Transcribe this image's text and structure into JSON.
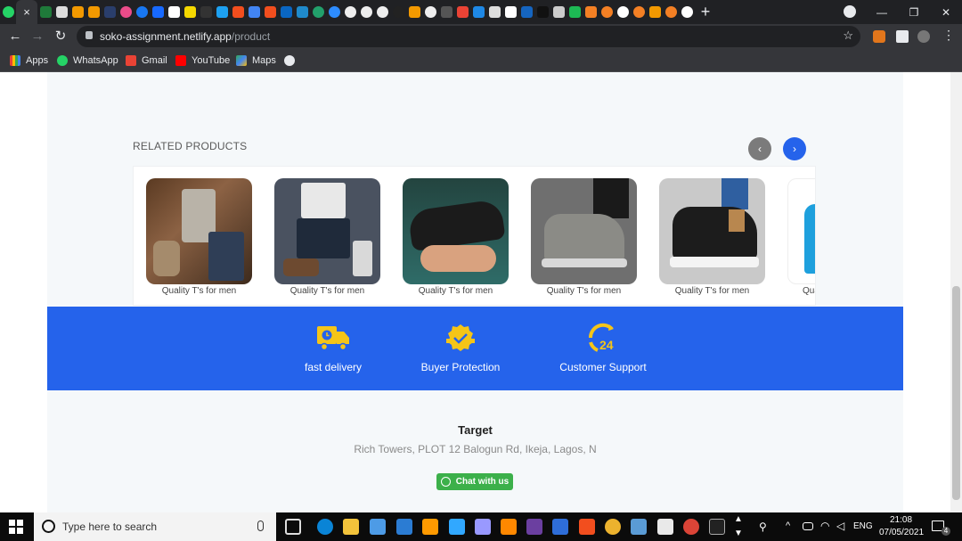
{
  "browser": {
    "url_host": "soko-assignment.netlify.app",
    "url_path": "/product",
    "active_tab_close": "×",
    "new_tab": "+",
    "window_controls": [
      "—",
      "❐",
      "✕"
    ]
  },
  "bookmarks": [
    {
      "label": "Apps",
      "icon": "apps-grid-icon"
    },
    {
      "label": "WhatsApp",
      "icon": "whatsapp-icon"
    },
    {
      "label": "Gmail",
      "icon": "gmail-icon"
    },
    {
      "label": "YouTube",
      "icon": "youtube-icon"
    },
    {
      "label": "Maps",
      "icon": "maps-icon"
    }
  ],
  "related": {
    "title": "RELATED PRODUCTS",
    "prev": "‹",
    "next": "›",
    "products": [
      {
        "caption": "Quality T's for men",
        "image": "flatlay-brown"
      },
      {
        "caption": "Quality T's for men",
        "image": "flatlay-grey"
      },
      {
        "caption": "Quality T's for men",
        "image": "black-sneaker"
      },
      {
        "caption": "Quality T's for men",
        "image": "grey-hightop"
      },
      {
        "caption": "Quality T's for men",
        "image": "black-hightop"
      },
      {
        "caption": "Qua",
        "image": "blue-tshirt"
      }
    ]
  },
  "features": [
    {
      "label": "fast delivery",
      "icon": "delivery-truck-icon"
    },
    {
      "label": "Buyer Protection",
      "icon": "badge-check-icon"
    },
    {
      "label": "Customer Support",
      "icon": "support-24-icon"
    }
  ],
  "footer": {
    "title": "Target",
    "address": "Rich Towers, PLOT 12 Balogun Rd, Ikeja, Lagos, N",
    "chat_label": "Chat with us"
  },
  "taskbar": {
    "search_placeholder": "Type here to search",
    "language": "ENG",
    "time": "21:08",
    "date": "07/05/2021",
    "notification_count": "4"
  },
  "colors": {
    "accent": "#2563eb",
    "feature_icon": "#f5c518",
    "chat_green": "#3cb04a"
  }
}
